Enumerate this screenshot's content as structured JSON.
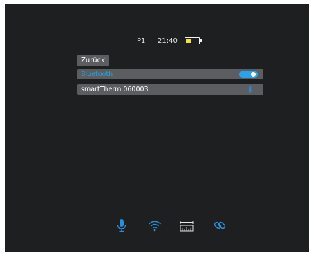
{
  "status_bar": {
    "profile": "P1",
    "time": "21:40",
    "battery_level": 0.45,
    "battery_color": "#f4e23a"
  },
  "menu": {
    "back_label": "Zurück",
    "bluetooth": {
      "label": "Bluetooth",
      "enabled": true,
      "accent": "#1fa7e8"
    },
    "device": {
      "label": "smartTherm  060003",
      "icon": "bluetooth-icon"
    }
  },
  "bottom_bar": {
    "icons": [
      "microphone-icon",
      "wifi-icon",
      "ruler-icon",
      "link-icon"
    ],
    "icon_color": "#2a8fd6"
  }
}
